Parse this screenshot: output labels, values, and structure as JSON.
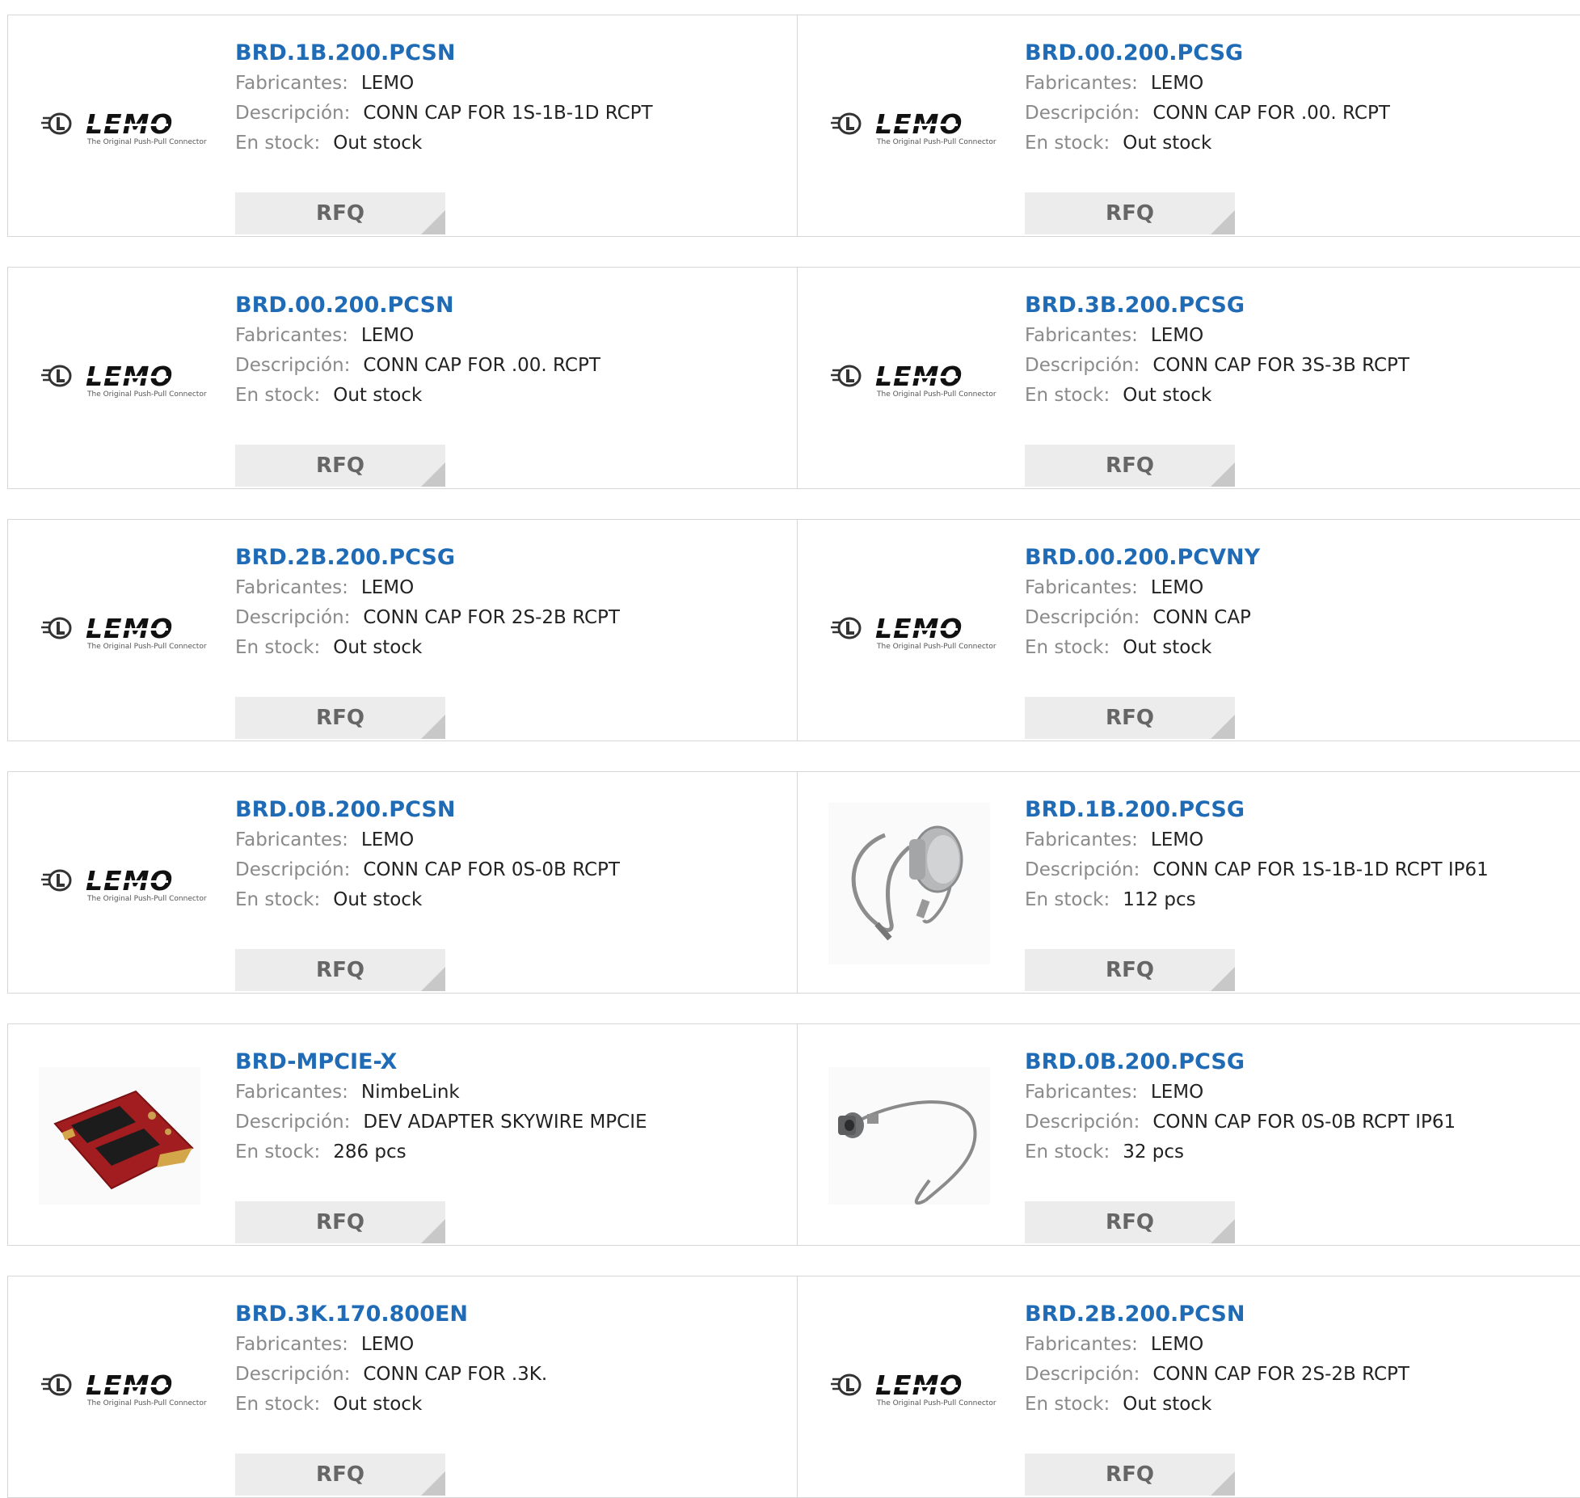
{
  "labels": {
    "manufacturer": "Fabricantes:",
    "description": "Descripción:",
    "stock": "En stock:",
    "rfq": "RFQ"
  },
  "logo": {
    "wordmark": "LEMO",
    "tagline": "The Original Push-Pull Connector"
  },
  "colors": {
    "part_link": "#1f6bb5",
    "rfq_bg": "#ececec",
    "border": "#d6d6d6"
  },
  "products": [
    {
      "part": "BRD.1B.200.PCSN",
      "manufacturer": "LEMO",
      "description": "CONN CAP FOR 1S-1B-1D RCPT",
      "stock": "Out stock",
      "image": "lemo-logo"
    },
    {
      "part": "BRD.00.200.PCSG",
      "manufacturer": "LEMO",
      "description": "CONN CAP FOR .00. RCPT",
      "stock": "Out stock",
      "image": "lemo-logo"
    },
    {
      "part": "BRD.00.200.PCSN",
      "manufacturer": "LEMO",
      "description": "CONN CAP FOR .00. RCPT",
      "stock": "Out stock",
      "image": "lemo-logo"
    },
    {
      "part": "BRD.3B.200.PCSG",
      "manufacturer": "LEMO",
      "description": "CONN CAP FOR 3S-3B RCPT",
      "stock": "Out stock",
      "image": "lemo-logo"
    },
    {
      "part": "BRD.2B.200.PCSG",
      "manufacturer": "LEMO",
      "description": "CONN CAP FOR 2S-2B RCPT",
      "stock": "Out stock",
      "image": "lemo-logo"
    },
    {
      "part": "BRD.00.200.PCVNY",
      "manufacturer": "LEMO",
      "description": "CONN CAP",
      "stock": "Out stock",
      "image": "lemo-logo"
    },
    {
      "part": "BRD.0B.200.PCSN",
      "manufacturer": "LEMO",
      "description": "CONN CAP FOR 0S-0B RCPT",
      "stock": "Out stock",
      "image": "lemo-logo"
    },
    {
      "part": "BRD.1B.200.PCSG",
      "manufacturer": "LEMO",
      "description": "CONN CAP FOR 1S-1B-1D RCPT IP61",
      "stock": "112 pcs",
      "image": "cap-with-lanyard"
    },
    {
      "part": "BRD-MPCIE-X",
      "manufacturer": "NimbeLink",
      "description": "DEV ADAPTER SKYWIRE MPCIE",
      "stock": "286 pcs",
      "image": "pcb-board"
    },
    {
      "part": "BRD.0B.200.PCSG",
      "manufacturer": "LEMO",
      "description": "CONN CAP FOR 0S-0B RCPT IP61",
      "stock": "32 pcs",
      "image": "cap-with-cable"
    },
    {
      "part": "BRD.3K.170.800EN",
      "manufacturer": "LEMO",
      "description": "CONN CAP FOR .3K.",
      "stock": "Out stock",
      "image": "lemo-logo"
    },
    {
      "part": "BRD.2B.200.PCSN",
      "manufacturer": "LEMO",
      "description": "CONN CAP FOR 2S-2B RCPT",
      "stock": "Out stock",
      "image": "lemo-logo"
    }
  ]
}
